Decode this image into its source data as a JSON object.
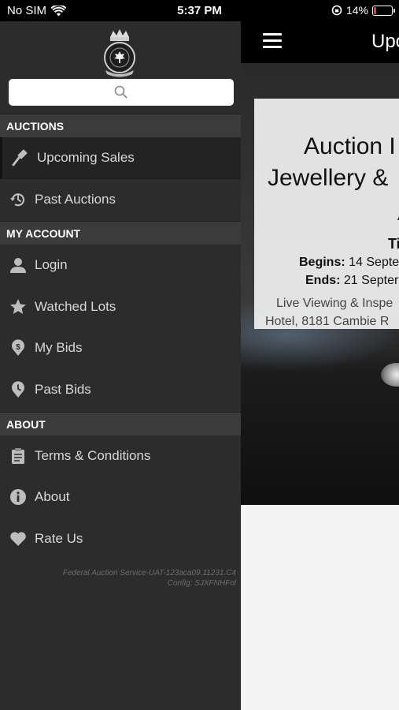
{
  "status_bar": {
    "carrier": "No SIM",
    "time": "5:37 PM",
    "battery_percent": "14%",
    "battery_level": 0.14
  },
  "drawer": {
    "search": {
      "placeholder": ""
    },
    "sections": {
      "auctions": "AUCTIONS",
      "my_account": "MY ACCOUNT",
      "about": "ABOUT"
    },
    "items": {
      "upcoming_sales": {
        "label": "Upcoming Sales",
        "icon": "gavel-icon"
      },
      "past_auctions": {
        "label": "Past Auctions",
        "icon": "history-icon"
      },
      "login": {
        "label": "Login",
        "icon": "user-icon"
      },
      "watched_lots": {
        "label": "Watched Lots",
        "icon": "star-icon"
      },
      "my_bids": {
        "label": "My Bids",
        "icon": "dollar-pin-icon"
      },
      "past_bids": {
        "label": "Past Bids",
        "icon": "clock-pin-icon"
      },
      "terms": {
        "label": "Terms & Conditions",
        "icon": "clipboard-icon"
      },
      "about": {
        "label": "About",
        "icon": "info-icon"
      },
      "rate_us": {
        "label": "Rate Us",
        "icon": "heart-icon"
      }
    },
    "footer": {
      "version": "Federal Auction Service-UAT-123aca09.11231.C4",
      "config": "Config: SJXFNHFol"
    }
  },
  "content": {
    "title": "Upc",
    "card": {
      "title_line1": "Auction I",
      "title_line2": "Jewellery &",
      "line_a": "A",
      "line_ti": "Ti",
      "begins_label": "Begins:",
      "begins_value": "14 Septe",
      "ends_label": "Ends:",
      "ends_value": "21 Septer",
      "live_viewing": "Live Viewing & Inspe",
      "hotel": "Hotel, 8181 Cambie R"
    }
  },
  "colors": {
    "drawer_bg": "#2c2c2c",
    "section_bg": "#3b3b3b",
    "active_item_bg": "#232323",
    "battery_low": "#e53935"
  }
}
